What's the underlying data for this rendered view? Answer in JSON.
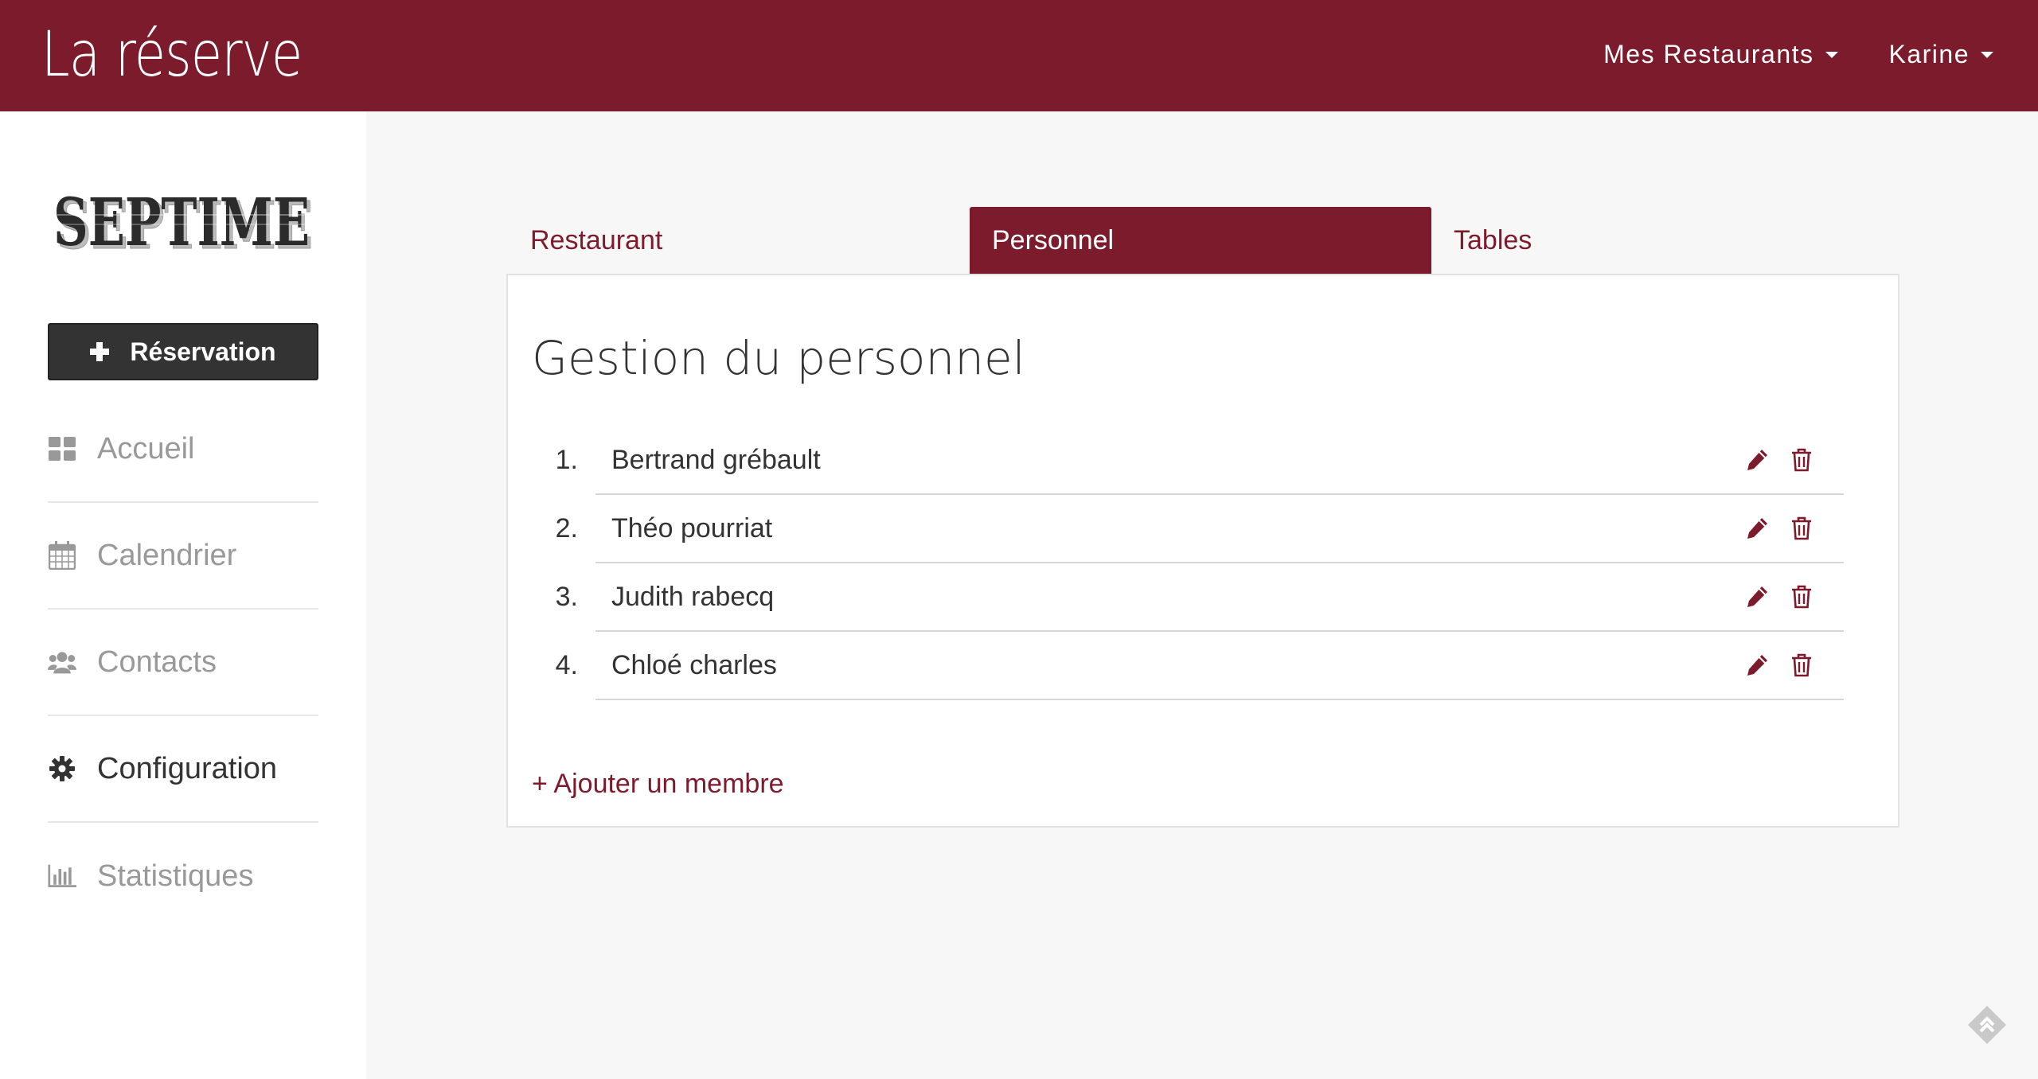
{
  "header": {
    "brand": "La réserve",
    "menu_restaurants": "Mes Restaurants",
    "menu_user": "Karine",
    "color": "#7b1b2c"
  },
  "sidebar": {
    "logo_text": "SEPTIME",
    "reservation_label": "Réservation",
    "items": [
      {
        "label": "Accueil",
        "icon": "dashboard-icon"
      },
      {
        "label": "Calendrier",
        "icon": "calendar-icon"
      },
      {
        "label": "Contacts",
        "icon": "users-icon"
      },
      {
        "label": "Configuration",
        "icon": "gear-icon",
        "active": true
      },
      {
        "label": "Statistiques",
        "icon": "bar-chart-icon"
      }
    ]
  },
  "tabs": [
    {
      "label": "Restaurant"
    },
    {
      "label": "Personnel",
      "active": true
    },
    {
      "label": "Tables"
    }
  ],
  "panel": {
    "title": "Gestion du personnel",
    "staff": [
      {
        "num": "1.",
        "name": "Bertrand grébault"
      },
      {
        "num": "2.",
        "name": "Théo pourriat"
      },
      {
        "num": "3.",
        "name": "Judith rabecq"
      },
      {
        "num": "4.",
        "name": "Chloé charles"
      }
    ],
    "add_label": "+ Ajouter un membre"
  }
}
